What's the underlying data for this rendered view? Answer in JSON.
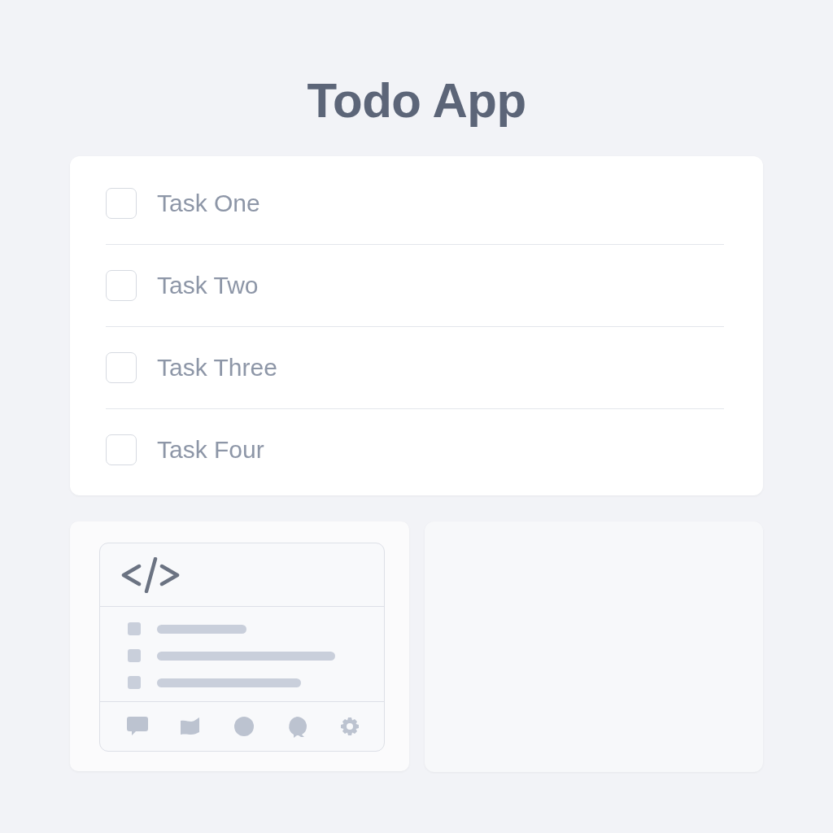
{
  "title": "Todo App",
  "tasks": [
    {
      "label": "Task One",
      "checked": false
    },
    {
      "label": "Task Two",
      "checked": false
    },
    {
      "label": "Task Three",
      "checked": false
    },
    {
      "label": "Task Four",
      "checked": false
    }
  ]
}
